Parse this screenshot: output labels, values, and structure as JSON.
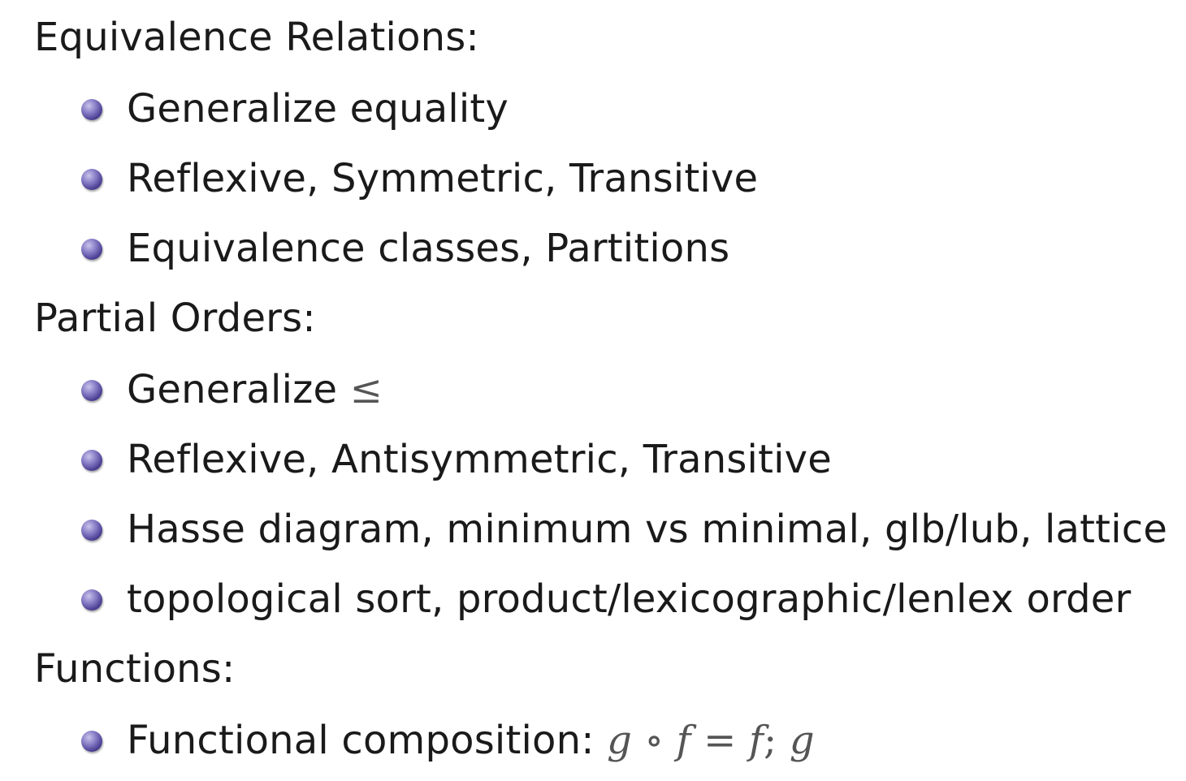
{
  "sections": [
    {
      "heading": "Equivalence Relations:",
      "items": [
        "Generalize equality",
        "Reflexive, Symmetric, Transitive",
        "Equivalence classes, Partitions"
      ]
    },
    {
      "heading": "Partial Orders:",
      "items": [
        "Generalize",
        "Reflexive, Antisymmetric, Transitive",
        "Hasse diagram, minimum vs minimal, glb/lub, lattice",
        "topological sort, product/lexicographic/lenlex order"
      ],
      "item0_math": "≤"
    },
    {
      "heading": "Functions:",
      "items": [
        "Functional composition:"
      ],
      "item0_math": {
        "g1": "g",
        "circ": "∘",
        "f1": "f",
        "eq": "=",
        "f2": "f",
        "semi": ";",
        "g2": "g"
      }
    }
  ]
}
